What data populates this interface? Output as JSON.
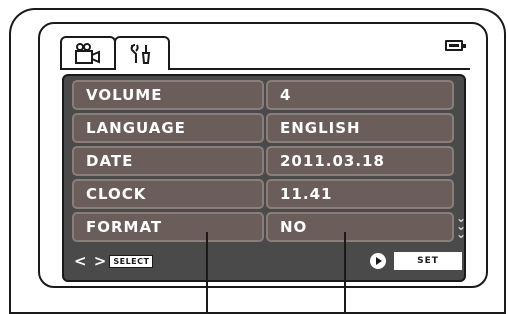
{
  "tabs": [
    {
      "icon": "video-camera-icon"
    },
    {
      "icon": "wrench-settings-icon"
    }
  ],
  "battery_icon": "battery-icon",
  "menu": {
    "rows": [
      {
        "label": "VOLUME",
        "value": "4"
      },
      {
        "label": "LANGUAGE",
        "value": "ENGLISH"
      },
      {
        "label": "DATE",
        "value": "2011.03.18"
      },
      {
        "label": "CLOCK",
        "value": "11.41"
      },
      {
        "label": "FORMAT",
        "value": "NO"
      }
    ]
  },
  "hints": {
    "select_arrows": "< >",
    "select_label": "SELECT",
    "set_label": "SET"
  },
  "colors": {
    "panel": "#4a4a4a",
    "row": "#6b5d5a",
    "text": "#ffffff"
  }
}
